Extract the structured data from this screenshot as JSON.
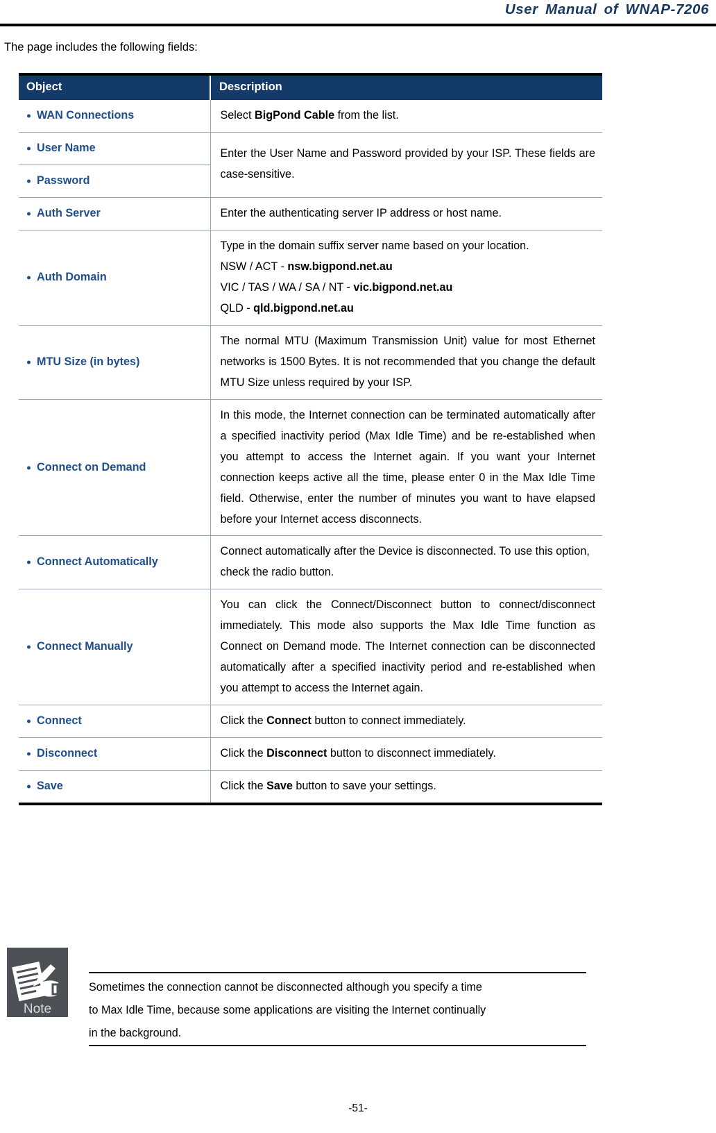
{
  "header": {
    "title": "User  Manual  of  WNAP-7206"
  },
  "intro": {
    "text": "The page includes the following fields:"
  },
  "table": {
    "columns": {
      "object": "Object",
      "description": "Description"
    },
    "rows": [
      {
        "object": "WAN Connections",
        "description_html": "Select <b>BigPond Cable</b> from the list."
      },
      {
        "object": "User Name",
        "object2": "Password",
        "description_html": "Enter the User Name and Password provided by your ISP. These fields are case-sensitive."
      },
      {
        "object": "Auth Server",
        "description_html": "Enter the authenticating server IP address or host name."
      },
      {
        "object": "Auth Domain",
        "lines": [
          "Type in the domain suffix server name based on your location.",
          "NSW / ACT - <b>nsw.bigpond.net.au</b>",
          "VIC / TAS / WA / SA / NT - <b>vic.bigpond.net.au</b>",
          "QLD - <b>qld.bigpond.net.au</b>"
        ]
      },
      {
        "object": "MTU Size (in bytes)",
        "description_html": "The normal MTU (Maximum Transmission Unit) value for most Ethernet networks is 1500 Bytes. It is not recommended that you change the default MTU Size unless required by your ISP."
      },
      {
        "object": "Connect on Demand",
        "description_html": "In this mode, the Internet connection can be terminated automatically after a specified inactivity period (Max Idle Time) and be re-established when you attempt to access the Internet again. If you want your Internet connection keeps active all the time, please enter 0 in the Max Idle Time field. Otherwise, enter the number of minutes you want to have elapsed before your Internet access disconnects."
      },
      {
        "object": "Connect Automatically",
        "description_html": "Connect automatically after the Device is disconnected. To use this option, check the radio button."
      },
      {
        "object": "Connect Manually",
        "description_html": "You can click the Connect/Disconnect button to connect/disconnect immediately. This mode also supports the Max Idle Time function as Connect on Demand mode. The Internet connection can be disconnected automatically after a specified inactivity period and re-established when you attempt to access the Internet again."
      },
      {
        "object": "Connect",
        "description_html": "Click the <b>Connect</b> button to connect immediately."
      },
      {
        "object": "Disconnect",
        "description_html": "Click the <b>Disconnect</b> button to disconnect immediately."
      },
      {
        "object": "Save",
        "description_html": "Click the <b>Save</b> button to save your settings."
      }
    ]
  },
  "note": {
    "icon_label": "Note",
    "lines": [
      "Sometimes the connection cannot be disconnected although you specify a time",
      "to Max Idle Time, because some applications are visiting the Internet continually",
      "in the background."
    ]
  },
  "footer": {
    "page_number": "-51-"
  },
  "colors": {
    "header_title": "#17375e",
    "table_header_bg": "#133a69",
    "object_text": "#1f4e8c",
    "note_icon_bg": "#4d5156",
    "rule": "#000000"
  }
}
